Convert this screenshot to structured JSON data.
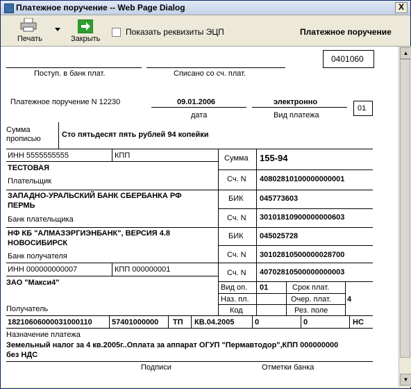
{
  "window": {
    "title": "Платежное поручение -- Web Page Dialog",
    "close": "X"
  },
  "toolbar": {
    "print_label": "Печать",
    "close_label": "Закрыть",
    "show_ecp_label": "Показать реквизиты ЭЦП",
    "doc_title": "Платежное поручение"
  },
  "form": {
    "okud": "0401060",
    "received_label": "Поступ. в банк плат.",
    "debited_label": "Списано со сч. плат.",
    "order_label": "Платежное поручение N 12230",
    "date_value": "09.01.2006",
    "date_label": "дата",
    "pay_type_value": "электронно",
    "pay_type_label": "Вид платежа",
    "status": "01",
    "sum_words_label_1": "Сумма",
    "sum_words_label_2": "прописью",
    "sum_words": "Сто пятьдесят пять рублей 94 копейки",
    "payer_inn": "ИНН 5555555555",
    "payer_kpp": "КПП",
    "sum_label": "Сумма",
    "sum_value": "155-94",
    "payer_name": "ТЕСТОВАЯ",
    "payer_label": "Плательщик",
    "acc_label": "Сч. N",
    "payer_acc": "40802810100000000001",
    "payer_bank_1": "ЗАПАДНО-УРАЛЬСКИЙ БАНК СБЕРБАНКА РФ",
    "payer_bank_2": "ПЕРМЬ",
    "bik_label": "БИК",
    "payer_bik": "045773603",
    "payer_bank_label": "Банк плательщика",
    "payer_corr": "30101810900000000603",
    "payee_bank_1": "НФ КБ \"АЛМАЗЭРГИЭНБАНК\", ВЕРСИЯ 4.8",
    "payee_bank_2": "НОВОСИБИРСК",
    "payee_bik": "045025728",
    "payee_bank_label": "Банк получателя",
    "payee_corr": "30102810500000028700",
    "payee_inn": "ИНН 000000000007",
    "payee_kpp": "КПП 000000001",
    "payee_acc": "40702810500000000003",
    "payee_name": "ЗАО \"Макси4\"",
    "payee_label": "Получатель",
    "op_type_label": "Вид оп.",
    "op_type": "01",
    "term_label": "Срок плат.",
    "purpose_code_label": "Наз. пл.",
    "priority_label": "Очер. плат.",
    "priority": "4",
    "code_label": "Код",
    "reserve_label": "Рез. поле",
    "kbk": "18210606000031000110",
    "okato": "57401000000",
    "basis": "ТП",
    "period": "КВ.04.2005",
    "doc_num": "0",
    "doc_date": "0",
    "pay_type_code": "НС",
    "purpose_label": "Назначение платежа",
    "purpose_1": "Земельный налог за 4 кв.2005г..Оплата за аппарат ОГУП \"Пермавтодор\",КПП 000000000",
    "purpose_2": "без НДС",
    "signatures_label": "Подписи",
    "bank_marks_label": "Отметки банка"
  }
}
